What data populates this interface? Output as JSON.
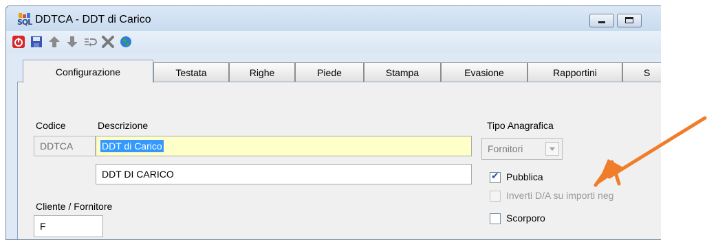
{
  "window": {
    "title": "DDTCA - DDT di Carico",
    "app_icon": "sql-app-icon"
  },
  "toolbar": {
    "icons": [
      "power-icon",
      "save-icon",
      "arrow-up-icon",
      "arrow-down-icon",
      "undo-icon",
      "delete-icon",
      "globe-icon"
    ]
  },
  "tabs": [
    {
      "label": "Configurazione",
      "active": true
    },
    {
      "label": "Testata"
    },
    {
      "label": "Righe"
    },
    {
      "label": "Piede"
    },
    {
      "label": "Stampa"
    },
    {
      "label": "Evasione"
    },
    {
      "label": "Rapportini"
    },
    {
      "label": "S"
    }
  ],
  "form": {
    "codice_label": "Codice",
    "codice_value": "DDTCA",
    "descrizione_label": "Descrizione",
    "descrizione_value": "DDT di Carico",
    "descrizione2_value": "DDT DI CARICO",
    "cliente_label": "Cliente / Fornitore",
    "cliente_value": "F",
    "tipo_label": "Tipo Anagrafica",
    "tipo_value": "Fornitori",
    "pubblica_label": "Pubblica",
    "pubblica_checked": true,
    "inverti_label": "Inverti D/A su importi neg",
    "inverti_checked": false,
    "scorporo_label": "Scorporo",
    "scorporo_checked": false
  },
  "colors": {
    "annotation_arrow": "#f07d2a",
    "selection": "#3399ff",
    "highlight_field": "#ffffc9"
  }
}
